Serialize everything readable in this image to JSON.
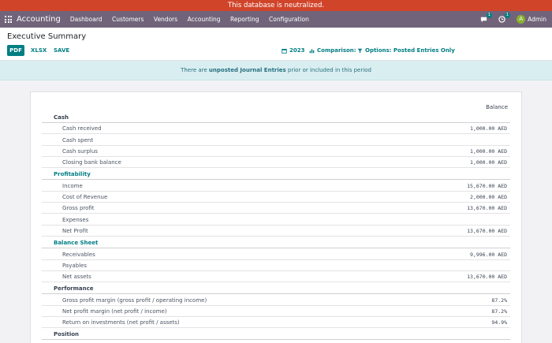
{
  "banner": {
    "text": "This database is neutralized."
  },
  "navbar": {
    "brand": "Accounting",
    "menu": [
      "Dashboard",
      "Customers",
      "Vendors",
      "Accounting",
      "Reporting",
      "Configuration"
    ],
    "messages_count": "1",
    "activities_count": "1",
    "user_initial": "A",
    "user_name": "Admin"
  },
  "control": {
    "title": "Executive Summary",
    "pdf_label": "PDF",
    "xlsx_label": "XLSX",
    "save_label": "SAVE",
    "date_filter": "2023",
    "comparison_filter": "Comparison:",
    "options_filter": "Options: Posted Entries Only"
  },
  "alert": {
    "prefix": "There are ",
    "link": "unposted Journal Entries",
    "suffix": " prior or included in this period"
  },
  "report": {
    "column_header": "Balance",
    "sections": [
      {
        "title": "Cash",
        "teal": false,
        "rows": [
          {
            "label": "Cash received",
            "value": "1,000.00 AED"
          },
          {
            "label": "Cash spent",
            "value": ""
          },
          {
            "label": "Cash surplus",
            "value": "1,000.00 AED"
          },
          {
            "label": "Closing bank balance",
            "value": "1,000.00 AED"
          }
        ]
      },
      {
        "title": "Profitability",
        "teal": true,
        "rows": [
          {
            "label": "Income",
            "value": "15,670.00 AED"
          },
          {
            "label": "Cost of Revenue",
            "value": "2,000.00 AED"
          },
          {
            "label": "Gross profit",
            "value": "13,670.00 AED"
          },
          {
            "label": "Expenses",
            "value": ""
          },
          {
            "label": "Net Profit",
            "value": "13,670.00 AED"
          }
        ]
      },
      {
        "title": "Balance Sheet",
        "teal": true,
        "rows": [
          {
            "label": "Receivables",
            "value": "9,996.00 AED"
          },
          {
            "label": "Payables",
            "value": ""
          },
          {
            "label": "Net assets",
            "value": "13,670.00 AED"
          }
        ]
      },
      {
        "title": "Performance",
        "teal": false,
        "rows": [
          {
            "label": "Gross profit margin (gross profit / operating income)",
            "value": "87.2%"
          },
          {
            "label": "Net profit margin (net profit / income)",
            "value": "87.2%"
          },
          {
            "label": "Return on investments (net profit / assets)",
            "value": "94.9%"
          }
        ]
      },
      {
        "title": "Position",
        "teal": false,
        "rows": []
      }
    ]
  }
}
